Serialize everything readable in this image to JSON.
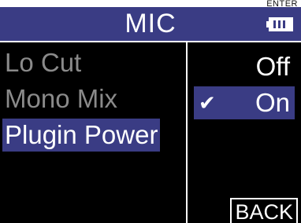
{
  "hint": {
    "enter": "ENTER"
  },
  "header": {
    "title": "MIC",
    "battery_icon": "battery-full-icon"
  },
  "menu": {
    "items": [
      {
        "label": "Lo Cut",
        "selected": false
      },
      {
        "label": "Mono Mix",
        "selected": false
      },
      {
        "label": "Plugin Power",
        "selected": true
      }
    ]
  },
  "options": {
    "items": [
      {
        "label": "Off",
        "selected": false
      },
      {
        "label": "On",
        "selected": true,
        "check_icon": "check-icon"
      }
    ]
  },
  "footer": {
    "back_label": "BACK"
  },
  "colors": {
    "accent": "#3a3c84",
    "background": "#000000",
    "text": "#ffffff",
    "inactive_text": "#8a8a8a"
  }
}
